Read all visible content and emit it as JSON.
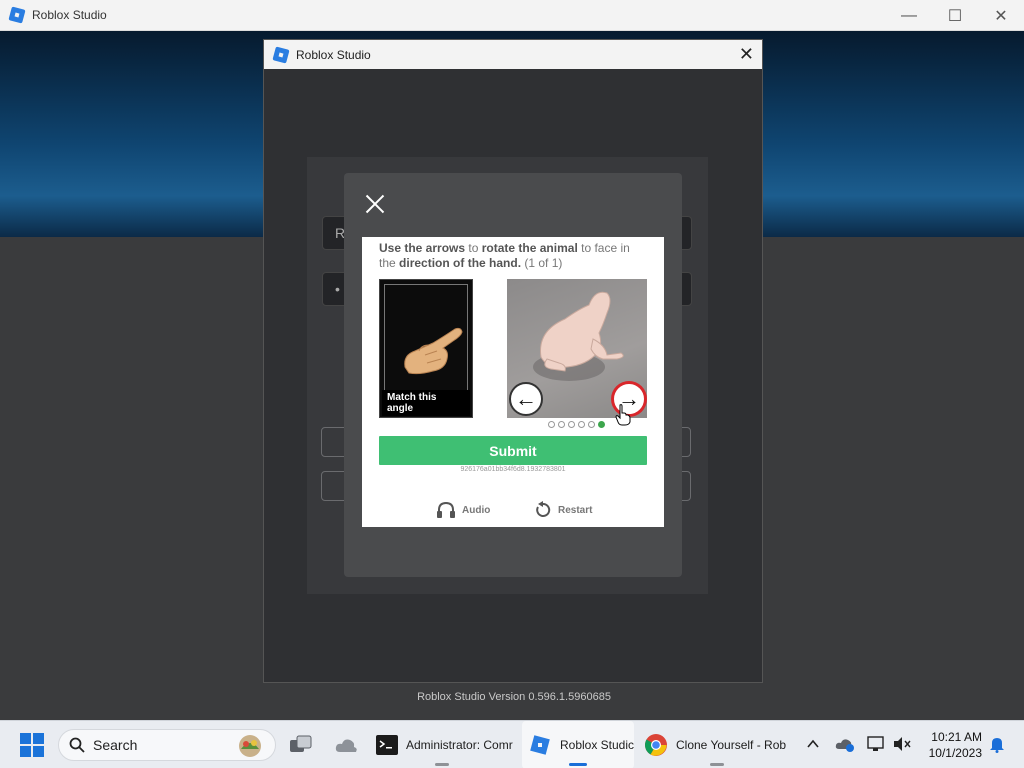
{
  "main_window": {
    "title": "Roblox Studio",
    "controls": {
      "minimize": "—",
      "maximize": "☐",
      "close": "✕"
    }
  },
  "login_window": {
    "title": "Roblox Studio",
    "close": "✕",
    "username_hint": "R",
    "password_hint": "•",
    "version": "Roblox Studio Version 0.596.1.5960685"
  },
  "captcha": {
    "instruction": {
      "part1": "Use the arrows",
      "part2": "to",
      "part3": "rotate the animal",
      "part4": "to face in the",
      "part5": "direction of the hand.",
      "part6": "(1 of 1)"
    },
    "reference_label": "Match this angle",
    "left_arrow": "←",
    "right_arrow": "→",
    "dots_total": 6,
    "dots_active_index": 5,
    "submit_label": "Submit",
    "session_id": "926176a01bb34f6d8.1932783801",
    "audio_label": "Audio",
    "restart_label": "Restart"
  },
  "taskbar": {
    "search_label": "Search",
    "apps": [
      {
        "label": "Administrator: Comr",
        "icon": "terminal-icon"
      },
      {
        "label": "Roblox Studic",
        "icon": "roblox-studio-icon",
        "active": true
      },
      {
        "label": "Clone Yourself - Rob",
        "icon": "chrome-icon"
      }
    ],
    "time": "10:21 AM",
    "date": "10/1/2023"
  }
}
